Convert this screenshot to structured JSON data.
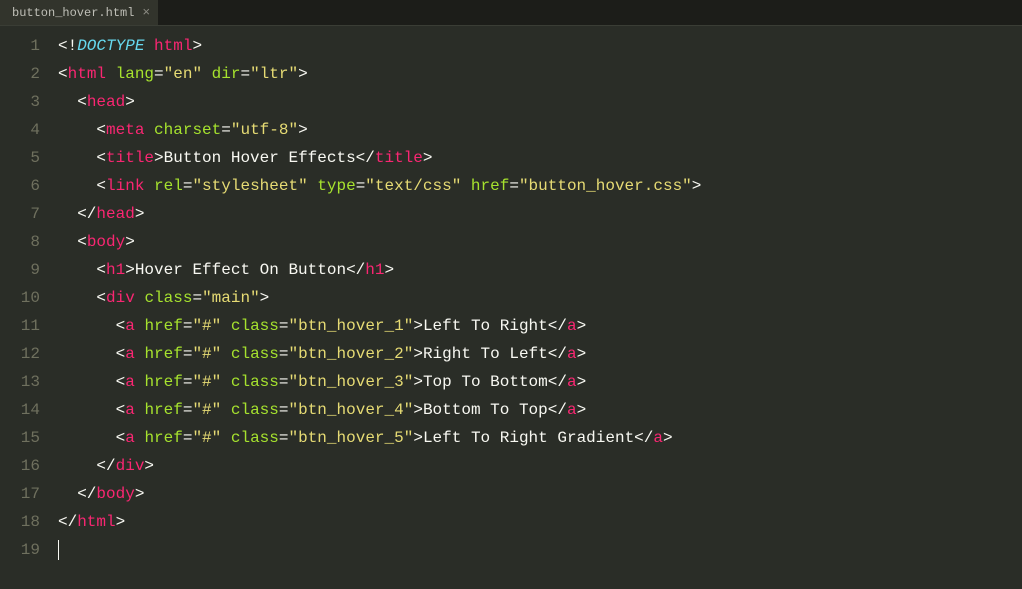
{
  "tab": {
    "filename": "button_hover.html"
  },
  "code": {
    "lines": [
      {
        "num": 1,
        "indent": 0,
        "type": "doctype",
        "doctype_kw": "DOCTYPE",
        "doctype_root": "html"
      },
      {
        "num": 2,
        "indent": 0,
        "type": "open",
        "tag": "html",
        "attrs": [
          [
            "lang",
            "en"
          ],
          [
            "dir",
            "ltr"
          ]
        ]
      },
      {
        "num": 3,
        "indent": 1,
        "type": "open",
        "tag": "head"
      },
      {
        "num": 4,
        "indent": 2,
        "type": "void",
        "tag": "meta",
        "attrs": [
          [
            "charset",
            "utf-8"
          ]
        ]
      },
      {
        "num": 5,
        "indent": 2,
        "type": "inline",
        "tag": "title",
        "text": "Button Hover Effects"
      },
      {
        "num": 6,
        "indent": 2,
        "type": "void",
        "tag": "link",
        "attrs": [
          [
            "rel",
            "stylesheet"
          ],
          [
            "type",
            "text/css"
          ],
          [
            "href",
            "button_hover.css"
          ]
        ]
      },
      {
        "num": 7,
        "indent": 1,
        "type": "close",
        "tag": "head"
      },
      {
        "num": 8,
        "indent": 1,
        "type": "open",
        "tag": "body"
      },
      {
        "num": 9,
        "indent": 2,
        "type": "inline",
        "tag": "h1",
        "text": "Hover Effect On Button"
      },
      {
        "num": 10,
        "indent": 2,
        "type": "open",
        "tag": "div",
        "attrs": [
          [
            "class",
            "main"
          ]
        ]
      },
      {
        "num": 11,
        "indent": 3,
        "type": "inline",
        "tag": "a",
        "attrs": [
          [
            "href",
            "#"
          ],
          [
            "class",
            "btn_hover_1"
          ]
        ],
        "text": "Left To Right"
      },
      {
        "num": 12,
        "indent": 3,
        "type": "inline",
        "tag": "a",
        "attrs": [
          [
            "href",
            "#"
          ],
          [
            "class",
            "btn_hover_2"
          ]
        ],
        "text": "Right To Left"
      },
      {
        "num": 13,
        "indent": 3,
        "type": "inline",
        "tag": "a",
        "attrs": [
          [
            "href",
            "#"
          ],
          [
            "class",
            "btn_hover_3"
          ]
        ],
        "text": "Top To Bottom"
      },
      {
        "num": 14,
        "indent": 3,
        "type": "inline",
        "tag": "a",
        "attrs": [
          [
            "href",
            "#"
          ],
          [
            "class",
            "btn_hover_4"
          ]
        ],
        "text": "Bottom To Top"
      },
      {
        "num": 15,
        "indent": 3,
        "type": "inline",
        "tag": "a",
        "attrs": [
          [
            "href",
            "#"
          ],
          [
            "class",
            "btn_hover_5"
          ]
        ],
        "text": "Left To Right Gradient"
      },
      {
        "num": 16,
        "indent": 2,
        "type": "close",
        "tag": "div"
      },
      {
        "num": 17,
        "indent": 1,
        "type": "close",
        "tag": "body"
      },
      {
        "num": 18,
        "indent": 0,
        "type": "close",
        "tag": "html"
      },
      {
        "num": 19,
        "indent": 0,
        "type": "empty"
      }
    ]
  },
  "editor": {
    "indent_unit": "  "
  }
}
